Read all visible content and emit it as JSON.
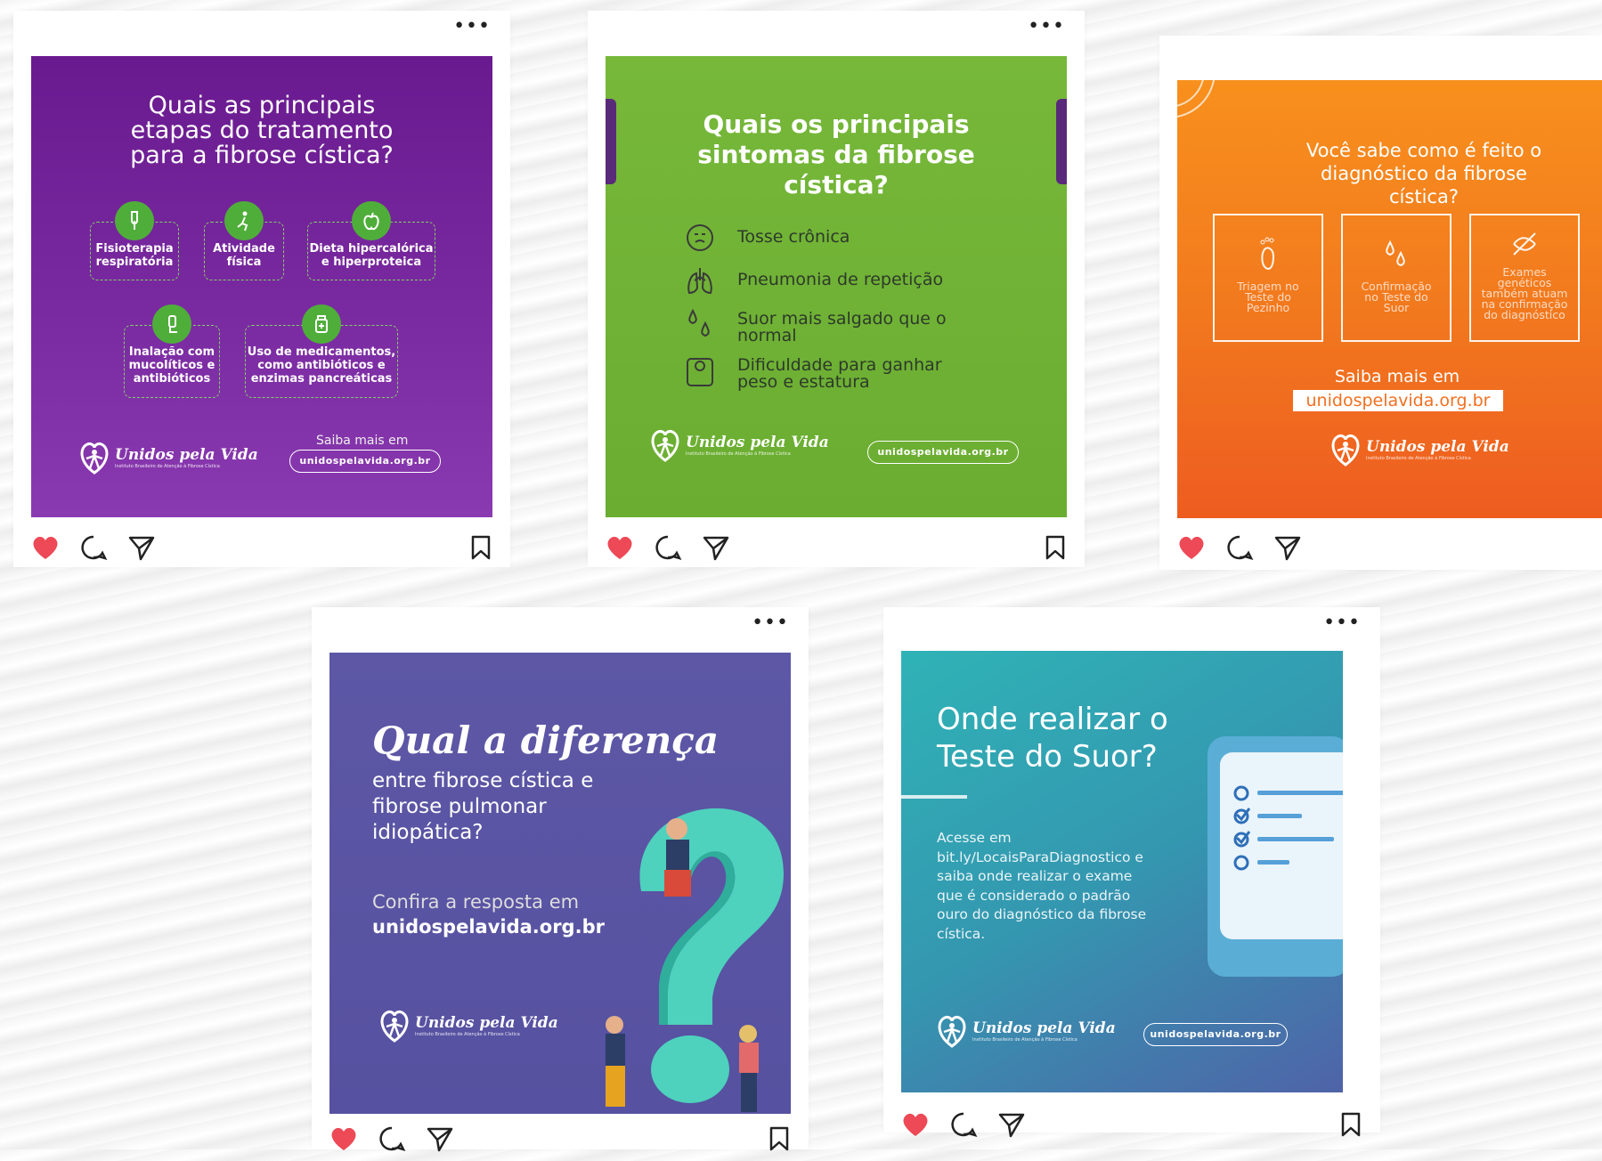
{
  "posts": [
    {
      "title": "Quais as principais etapas do tratamento para a fibrose cística?",
      "steps": [
        "Fisioterapia respiratória",
        "Atividade física",
        "Dieta hipercalórica e hiperproteica",
        "Inalação com mucolíticos e antibióticos",
        "Uso de medicamentos, como antibióticos e enzimas pancreáticas"
      ],
      "cta": "Saiba mais em",
      "url": "unidospelavida.org.br",
      "brand": "Unidos pela Vida",
      "brand_sub": "Instituto Brasileiro de Atenção à Fibrose Cística"
    },
    {
      "title": "Quais os principais sintomas da fibrose cística?",
      "symptoms": [
        "Tosse crônica",
        "Pneumonia de repetição",
        "Suor mais salgado que o normal",
        "Dificuldade para ganhar peso e estatura"
      ],
      "url": "unidospelavida.org.br",
      "brand": "Unidos pela Vida",
      "brand_sub": "Instituto Brasileiro de Atenção à Fibrose Cística"
    },
    {
      "title": "Você sabe como é feito o diagnóstico da fibrose cística?",
      "tests": [
        "Triagem no Teste do Pezinho",
        "Confirmação no Teste do Suor",
        "Exames genéticos também atuam na confirmação do diagnóstico"
      ],
      "cta": "Saiba mais em",
      "url": "unidospelavida.org.br",
      "brand": "Unidos pela Vida",
      "brand_sub": "Instituto Brasileiro de Atenção à Fibrose Cística"
    },
    {
      "title": "Qual a diferença",
      "subtitle": "entre fibrose cística e fibrose pulmonar idiopática?",
      "cta": "Confira a resposta em",
      "url": "unidospelavida.org.br",
      "brand": "Unidos pela Vida",
      "brand_sub": "Instituto Brasileiro de Atenção à Fibrose Cística"
    },
    {
      "title": "Onde realizar o Teste do Suor?",
      "body": "Acesse em bit.ly/LocaisParaDiagnostico e saiba onde realizar o exame que é considerado o padrão ouro do diagnóstico da fibrose cística.",
      "url": "unidospelavida.org.br",
      "brand": "Unidos pela Vida",
      "brand_sub": "Instituto Brasileiro de Atenção à Fibrose Cística"
    }
  ],
  "menu_glyph": "•••",
  "colors": {
    "heart": "#ed4956",
    "purple": "#6a1a8f",
    "green": "#6aad31",
    "orange": "#f27a1e",
    "violet": "#5a55a3",
    "teal": "#3497b0"
  }
}
